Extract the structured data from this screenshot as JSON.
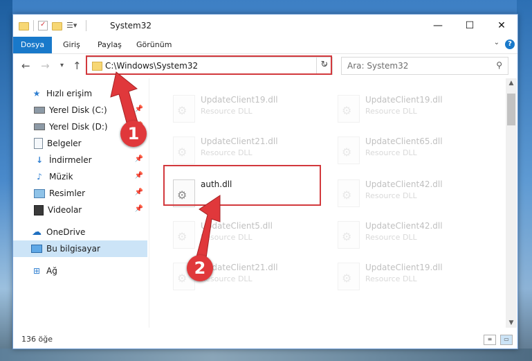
{
  "window": {
    "title": "System32"
  },
  "ribbon": {
    "tabs": [
      "Dosya",
      "Giriş",
      "Paylaş",
      "Görünüm"
    ],
    "help_label": "?"
  },
  "nav": {
    "address": "C:\\Windows\\System32",
    "search_placeholder": "Ara: System32"
  },
  "sidebar": {
    "items": [
      {
        "label": "Hızlı erişim",
        "icon": "star-icon",
        "pinned": false
      },
      {
        "label": "Yerel Disk (C:)",
        "icon": "drive-icon",
        "pinned": true
      },
      {
        "label": "Yerel Disk (D:)",
        "icon": "drive-icon",
        "pinned": true
      },
      {
        "label": "Belgeler",
        "icon": "document-icon",
        "pinned": true
      },
      {
        "label": "İndirmeler",
        "icon": "download-icon",
        "pinned": true
      },
      {
        "label": "Müzik",
        "icon": "music-icon",
        "pinned": true
      },
      {
        "label": "Resimler",
        "icon": "pictures-icon",
        "pinned": true
      },
      {
        "label": "Videolar",
        "icon": "video-icon",
        "pinned": true
      },
      {
        "label": "OneDrive",
        "icon": "cloud-icon",
        "pinned": false
      },
      {
        "label": "Bu bilgisayar",
        "icon": "computer-icon",
        "pinned": false,
        "selected": true
      },
      {
        "label": "Ağ",
        "icon": "network-icon",
        "pinned": false
      }
    ]
  },
  "files": [
    {
      "name": "UpdateClient19.dll",
      "type": "Resource DLL",
      "faded": true
    },
    {
      "name": "UpdateClient19.dll",
      "type": "Resource DLL",
      "faded": true
    },
    {
      "name": "UpdateClient21.dll",
      "type": "Resource DLL",
      "faded": true
    },
    {
      "name": "UpdateClient65.dll",
      "type": "Resource DLL",
      "faded": true
    },
    {
      "name": "auth.dll",
      "type": "",
      "faded": false,
      "highlighted": true
    },
    {
      "name": "UpdateClient42.dll",
      "type": "Resource DLL",
      "faded": true
    },
    {
      "name": "UpdateClient5.dll",
      "type": "Resource DLL",
      "faded": true
    },
    {
      "name": "UpdateClient42.dll",
      "type": "Resource DLL",
      "faded": true
    },
    {
      "name": "UpdateClient21.dll",
      "type": "Resource DLL",
      "faded": true
    },
    {
      "name": "UpdateClient19.dll",
      "type": "Resource DLL",
      "faded": true
    }
  ],
  "status": {
    "item_count": "136 öğe"
  },
  "annotations": {
    "callout_1": "1",
    "callout_2": "2",
    "highlight_color": "#d2383c"
  },
  "colors": {
    "accent": "#1979ca",
    "selected_bg": "#cce4f7"
  }
}
